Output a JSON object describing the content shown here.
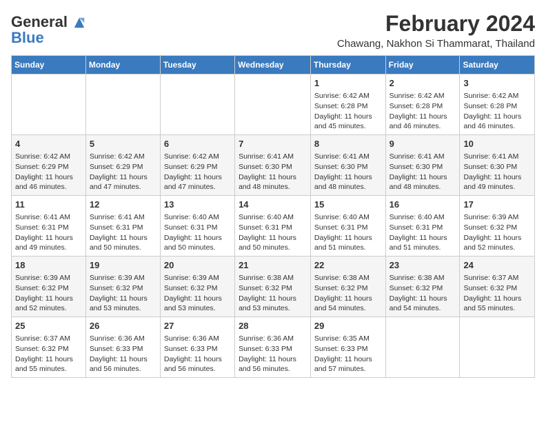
{
  "header": {
    "logo_line1": "General",
    "logo_line2": "Blue",
    "title": "February 2024",
    "subtitle": "Chawang, Nakhon Si Thammarat, Thailand"
  },
  "columns": [
    "Sunday",
    "Monday",
    "Tuesday",
    "Wednesday",
    "Thursday",
    "Friday",
    "Saturday"
  ],
  "weeks": [
    [
      {
        "day": "",
        "info": ""
      },
      {
        "day": "",
        "info": ""
      },
      {
        "day": "",
        "info": ""
      },
      {
        "day": "",
        "info": ""
      },
      {
        "day": "1",
        "info": "Sunrise: 6:42 AM\nSunset: 6:28 PM\nDaylight: 11 hours and 45 minutes."
      },
      {
        "day": "2",
        "info": "Sunrise: 6:42 AM\nSunset: 6:28 PM\nDaylight: 11 hours and 46 minutes."
      },
      {
        "day": "3",
        "info": "Sunrise: 6:42 AM\nSunset: 6:28 PM\nDaylight: 11 hours and 46 minutes."
      }
    ],
    [
      {
        "day": "4",
        "info": "Sunrise: 6:42 AM\nSunset: 6:29 PM\nDaylight: 11 hours and 46 minutes."
      },
      {
        "day": "5",
        "info": "Sunrise: 6:42 AM\nSunset: 6:29 PM\nDaylight: 11 hours and 47 minutes."
      },
      {
        "day": "6",
        "info": "Sunrise: 6:42 AM\nSunset: 6:29 PM\nDaylight: 11 hours and 47 minutes."
      },
      {
        "day": "7",
        "info": "Sunrise: 6:41 AM\nSunset: 6:30 PM\nDaylight: 11 hours and 48 minutes."
      },
      {
        "day": "8",
        "info": "Sunrise: 6:41 AM\nSunset: 6:30 PM\nDaylight: 11 hours and 48 minutes."
      },
      {
        "day": "9",
        "info": "Sunrise: 6:41 AM\nSunset: 6:30 PM\nDaylight: 11 hours and 48 minutes."
      },
      {
        "day": "10",
        "info": "Sunrise: 6:41 AM\nSunset: 6:30 PM\nDaylight: 11 hours and 49 minutes."
      }
    ],
    [
      {
        "day": "11",
        "info": "Sunrise: 6:41 AM\nSunset: 6:31 PM\nDaylight: 11 hours and 49 minutes."
      },
      {
        "day": "12",
        "info": "Sunrise: 6:41 AM\nSunset: 6:31 PM\nDaylight: 11 hours and 50 minutes."
      },
      {
        "day": "13",
        "info": "Sunrise: 6:40 AM\nSunset: 6:31 PM\nDaylight: 11 hours and 50 minutes."
      },
      {
        "day": "14",
        "info": "Sunrise: 6:40 AM\nSunset: 6:31 PM\nDaylight: 11 hours and 50 minutes."
      },
      {
        "day": "15",
        "info": "Sunrise: 6:40 AM\nSunset: 6:31 PM\nDaylight: 11 hours and 51 minutes."
      },
      {
        "day": "16",
        "info": "Sunrise: 6:40 AM\nSunset: 6:31 PM\nDaylight: 11 hours and 51 minutes."
      },
      {
        "day": "17",
        "info": "Sunrise: 6:39 AM\nSunset: 6:32 PM\nDaylight: 11 hours and 52 minutes."
      }
    ],
    [
      {
        "day": "18",
        "info": "Sunrise: 6:39 AM\nSunset: 6:32 PM\nDaylight: 11 hours and 52 minutes."
      },
      {
        "day": "19",
        "info": "Sunrise: 6:39 AM\nSunset: 6:32 PM\nDaylight: 11 hours and 53 minutes."
      },
      {
        "day": "20",
        "info": "Sunrise: 6:39 AM\nSunset: 6:32 PM\nDaylight: 11 hours and 53 minutes."
      },
      {
        "day": "21",
        "info": "Sunrise: 6:38 AM\nSunset: 6:32 PM\nDaylight: 11 hours and 53 minutes."
      },
      {
        "day": "22",
        "info": "Sunrise: 6:38 AM\nSunset: 6:32 PM\nDaylight: 11 hours and 54 minutes."
      },
      {
        "day": "23",
        "info": "Sunrise: 6:38 AM\nSunset: 6:32 PM\nDaylight: 11 hours and 54 minutes."
      },
      {
        "day": "24",
        "info": "Sunrise: 6:37 AM\nSunset: 6:32 PM\nDaylight: 11 hours and 55 minutes."
      }
    ],
    [
      {
        "day": "25",
        "info": "Sunrise: 6:37 AM\nSunset: 6:32 PM\nDaylight: 11 hours and 55 minutes."
      },
      {
        "day": "26",
        "info": "Sunrise: 6:36 AM\nSunset: 6:33 PM\nDaylight: 11 hours and 56 minutes."
      },
      {
        "day": "27",
        "info": "Sunrise: 6:36 AM\nSunset: 6:33 PM\nDaylight: 11 hours and 56 minutes."
      },
      {
        "day": "28",
        "info": "Sunrise: 6:36 AM\nSunset: 6:33 PM\nDaylight: 11 hours and 56 minutes."
      },
      {
        "day": "29",
        "info": "Sunrise: 6:35 AM\nSunset: 6:33 PM\nDaylight: 11 hours and 57 minutes."
      },
      {
        "day": "",
        "info": ""
      },
      {
        "day": "",
        "info": ""
      }
    ]
  ]
}
